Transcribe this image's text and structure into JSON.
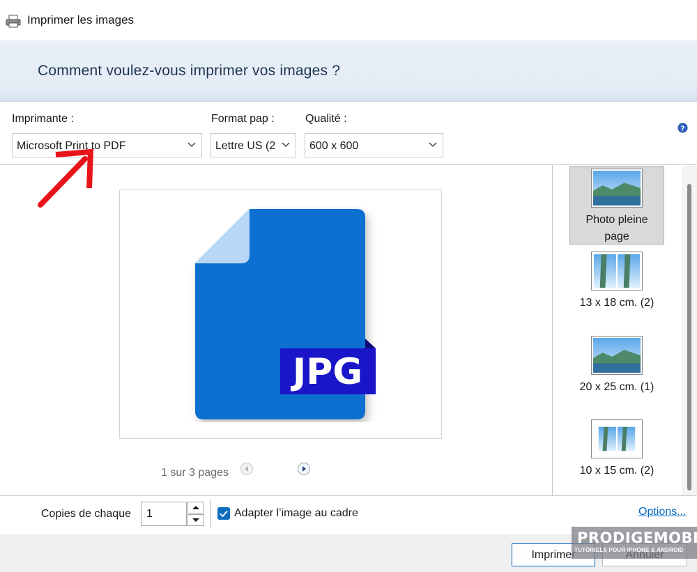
{
  "window": {
    "title": "Imprimer les images",
    "icon": "printer-icon"
  },
  "header": {
    "question": "Comment voulez-vous imprimer vos images ?"
  },
  "options": {
    "printer": {
      "label": "Imprimante :",
      "value": "Microsoft Print to PDF"
    },
    "paper_format": {
      "label": "Format pap :",
      "value": "Lettre US (2"
    },
    "quality": {
      "label": "Qualité :",
      "value": "600 x 600"
    },
    "help_icon": "help-icon"
  },
  "preview": {
    "file_type": "JPG",
    "pager": "1 sur 3 pages",
    "colors": {
      "file_body": "#0a6fd1",
      "file_fold": "#b8d7f6",
      "badge": "#1a15c8"
    }
  },
  "layouts": [
    {
      "label": "Photo pleine page",
      "selected": true
    },
    {
      "label": "13 x 18 cm. (2)",
      "selected": false
    },
    {
      "label": "20 x 25 cm. (1)",
      "selected": false
    },
    {
      "label": "10 x 15 cm. (2)",
      "selected": false
    }
  ],
  "bottom": {
    "copies_label": "Copies de chaque",
    "copies_value": "1",
    "fit_label": "Adapter l’image au cadre",
    "fit_checked": true,
    "options_link": "Options..."
  },
  "footer": {
    "print_button": "Imprimer",
    "cancel_button": "Annuler"
  },
  "watermark": {
    "brand": "PRODIGEMOBILE",
    "tagline": "TUTORIELS POUR IPHONE & ANDROID"
  },
  "accent_color": "#0f6cbd",
  "annotation_arrow_color": "#e8141a"
}
